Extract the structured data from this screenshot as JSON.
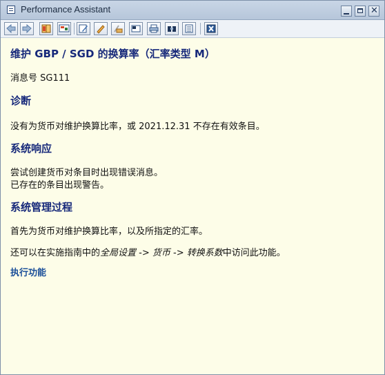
{
  "window": {
    "title": "Performance Assistant"
  },
  "toolbar": {
    "buttons": [
      {
        "name": "back-arrow-icon"
      },
      {
        "name": "forward-arrow-icon"
      },
      {
        "name": "book-icon"
      },
      {
        "name": "technical-info-icon"
      },
      {
        "name": "edit-icon"
      },
      {
        "name": "pencil-icon"
      },
      {
        "name": "link-icon"
      },
      {
        "name": "page-icon"
      },
      {
        "name": "print-icon"
      },
      {
        "name": "find-icon"
      },
      {
        "name": "document-icon"
      },
      {
        "name": "close-window-icon"
      }
    ]
  },
  "doc": {
    "title": "维护 GBP / SGD 的换算率（汇率类型 M）",
    "message_no": "消息号 SG111",
    "diag_heading": "诊断",
    "diag_text": "没有为货币对维护换算比率，或 2021.12.31 不存在有效条目。",
    "resp_heading": "系统响应",
    "resp_line1": "尝试创建货币对条目时出现错误消息。",
    "resp_line2": "已存在的条目出现警告。",
    "admin_heading": "系统管理过程",
    "admin_text1": "首先为货币对维护换算比率，以及所指定的汇率。",
    "admin_text2_pre": "还可以在实施指南中的",
    "admin_path1": "全局设置",
    "admin_arrow1": " -> ",
    "admin_path2": "货币",
    "admin_arrow2": " -> ",
    "admin_path3": "转换系数",
    "admin_text2_post": "中访问此功能。",
    "execute_link": "执行功能"
  }
}
